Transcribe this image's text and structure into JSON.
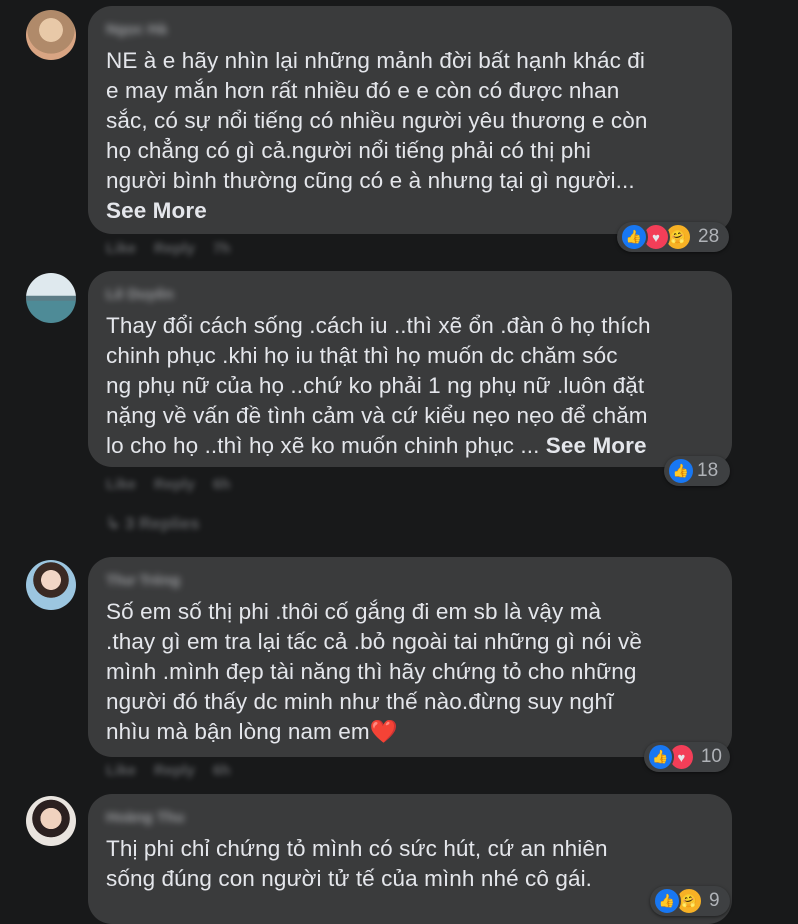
{
  "comments": [
    {
      "author": "Ngọc Hà",
      "text": "NE à e hãy nhìn lại những mảnh đời bất hạnh khác đi\ne may mắn hơn rất nhiều đó e e còn có được nhan\nsắc, có sự nổi tiếng có nhiều người yêu thương e còn\nhọ chẳng có gì cả.người nổi tiếng phải có thị phi\nngười bình thường cũng có e à nhưng tại gì người...",
      "see_more": "See More",
      "reaction_count": "28",
      "reactions": [
        "like-icon",
        "love-icon",
        "care-icon"
      ],
      "actions": [
        "Like",
        "Reply",
        "7h"
      ]
    },
    {
      "author": "Lê Duyên",
      "text": "Thay đổi cách sống .cách iu ..thì xẽ ổn .đàn ô họ thích\nchinh phục .khi họ iu thật thì họ muốn dc chăm sóc\nng phụ nữ của họ ..chứ ko phải 1 ng phụ nữ .luôn đặt\nnặng về vấn đề tình cảm và cứ kiểu nẹo nẹo để chăm\nlo cho họ ..thì họ xẽ ko muốn chinh phục ... ",
      "see_more": "See More",
      "reaction_count": "18",
      "reactions": [
        "like-icon"
      ],
      "actions": [
        "Like",
        "Reply",
        "6h"
      ],
      "replies_label": "3 Replies"
    },
    {
      "author": "Thư Trẻng",
      "text": "Số em số thị phi .thôi cố gắng đi em sb là vậy mà\n.thay gì em tra lại tấc cả .bỏ ngoài tai những gì nói về\nmình .mình đẹp tài năng thì hãy chứng tỏ cho những\nngười đó thấy dc minh như thế nào.đừng suy nghĩ\nnhìu mà bận lòng nam em",
      "heart_emoji": "❤️",
      "reaction_count": "10",
      "reactions": [
        "like-icon",
        "love-icon"
      ],
      "actions": [
        "Like",
        "Reply",
        "6h"
      ]
    },
    {
      "author": "Hoàng Thu",
      "text": "Thị phi chỉ chứng tỏ mình có sức hút, cứ an nhiên\nsống đúng con người tử tế của mình nhé cô gái.",
      "reaction_count": "9",
      "reactions": [
        "like-icon",
        "care-icon"
      ]
    }
  ]
}
